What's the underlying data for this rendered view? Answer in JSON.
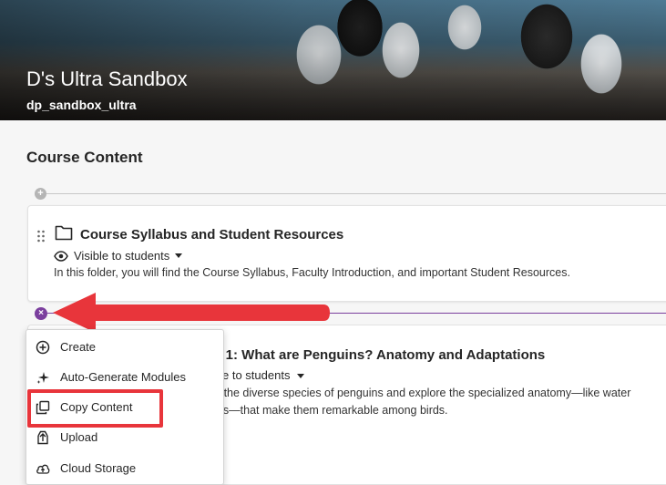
{
  "banner": {
    "course_title": "D's Ultra Sandbox",
    "course_id": "dp_sandbox_ultra"
  },
  "content": {
    "section_title": "Course Content",
    "folder": {
      "title": "Course Syllabus and Student Resources",
      "visibility": "Visible to students",
      "description": "In this folder, you will find the Course Syllabus, Faculty Introduction, and important Student Resources."
    },
    "module": {
      "title_partial": "le 1: What are Penguins? Anatomy and Adaptations",
      "visibility_partial": "ible to students",
      "description_line1": "er the diverse species of penguins and explore the specialized anatomy—like water",
      "description_line2": "ngs—that make them remarkable among birds."
    }
  },
  "menu": {
    "items": [
      {
        "label": "Create",
        "icon": "plus-circle-icon"
      },
      {
        "label": "Auto-Generate Modules",
        "icon": "sparkle-icon"
      },
      {
        "label": "Copy Content",
        "icon": "copy-icon"
      },
      {
        "label": "Upload",
        "icon": "upload-icon"
      },
      {
        "label": "Cloud Storage",
        "icon": "cloud-upload-icon"
      }
    ]
  },
  "colors": {
    "accent_purple": "#7b3f9e",
    "annotation_red": "#e8353b"
  }
}
